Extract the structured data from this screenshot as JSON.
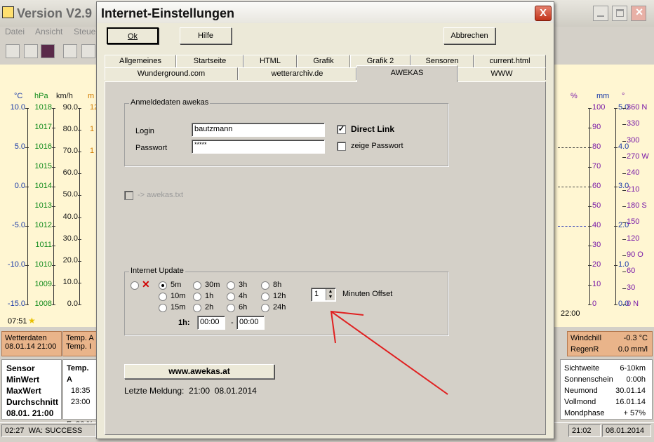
{
  "main": {
    "title": "Version V2.9",
    "menu": [
      "Datei",
      "Ansicht",
      "Steue"
    ]
  },
  "chart": {
    "units": {
      "temp": "°C",
      "press": "hPa",
      "wind": "km/h",
      "orange": "m",
      "hum": "%",
      "rain": "mm",
      "dir": "°"
    },
    "temp_ticks": [
      "10.0",
      "5.0",
      "0.0",
      "-5.0",
      "-10.0",
      "-15.0"
    ],
    "press_ticks": [
      "1018",
      "1017",
      "1016",
      "1015",
      "1014",
      "1013",
      "1012",
      "1011",
      "1010",
      "1009",
      "1008"
    ],
    "wind_ticks": [
      "90.0",
      "80.0",
      "70.0",
      "60.0",
      "50.0",
      "40.0",
      "30.0",
      "20.0",
      "10.0",
      "0.0"
    ],
    "orange_ticks": [
      "12",
      "1",
      "1"
    ],
    "hum_ticks": [
      "100",
      "90",
      "80",
      "70",
      "60",
      "50",
      "40",
      "30",
      "20",
      "10",
      "0"
    ],
    "rain_ticks": [
      "5.0",
      "4.0",
      "3.0",
      "2.0",
      "1.0",
      "0.0"
    ],
    "dir_ticks": [
      "360 N",
      "330",
      "300",
      "270 W",
      "240",
      "210",
      "180 S",
      "150",
      "120",
      "90  O",
      "60",
      "30",
      "0    N"
    ],
    "time_left": "07:51",
    "time_right": "22:00"
  },
  "bottom": {
    "wetterdaten": "Wetterdaten",
    "wetter_date": "08.01.14 21:00",
    "tempA": "Temp. A",
    "tempI": "Temp. I",
    "sensor": "Sensor",
    "minwert": "MinWert",
    "maxwert": "MaxWert",
    "durchschnitt": "Durchschnitt",
    "date_row": "08.01.  21:00",
    "temp_head": "Temp. A",
    "min_t": "18:35",
    "max_t": "23:00",
    "feuchte": "F: 86 %",
    "windchill": "Windchill",
    "windchill_val": "-0.3 °C",
    "regenr": "RegenR",
    "regenr_val": "0.0 mm/l",
    "sichtweite": "Sichtweite",
    "sichtweite_val": "6-10km",
    "sonnenschein": "Sonnenschein",
    "sonnenschein_val": "0:00h",
    "neumond": "Neumond",
    "neumond_val": "30.01.14",
    "vollmond": "Vollmond",
    "vollmond_val": "16.01.14",
    "mondphase": "Mondphase",
    "mondphase_val": "+ 57%"
  },
  "status": {
    "time": "02:27",
    "msg": "WA: SUCCESS",
    "time2": "21:02",
    "date": "08.01.2014"
  },
  "dialog": {
    "title": "Internet-Einstellungen",
    "close": "X",
    "ok": "Ok",
    "hilfe": "Hilfe",
    "abbrechen": "Abbrechen",
    "tabs_row1": [
      "Allgemeines",
      "Startseite",
      "HTML",
      "Grafik",
      "Grafik 2",
      "Sensoren",
      "current.html"
    ],
    "tabs_row2": [
      "Wunderground.com",
      "wetterarchiv.de",
      "AWEKAS",
      "WWW"
    ],
    "group_login": "Anmeldedaten awekas",
    "login_label": "Login",
    "login_value": "bautzmann",
    "password_label": "Passwort",
    "password_value": "*****",
    "direct_link": "Direct Link",
    "show_pw": "zeige Passwort",
    "awekas_txt": "-> awekas.txt",
    "group_update": "Internet Update",
    "off_mark": "✕",
    "intervals": [
      "5m",
      "30m",
      "3h",
      "8h",
      "10m",
      "1h",
      "4h",
      "12h",
      "15m",
      "2h",
      "6h",
      "24h"
    ],
    "selected_interval": "5m",
    "offset_value": "1",
    "offset_label": "Minuten Offset",
    "h1_label": "1h:",
    "h1_from": "00:00",
    "h1_sep": "-",
    "h1_to": "00:00",
    "awekas_button": "www.awekas.at",
    "last_msg_label": "Letzte Meldung:",
    "last_msg_time": "21:00",
    "last_msg_date": "08.01.2014"
  }
}
